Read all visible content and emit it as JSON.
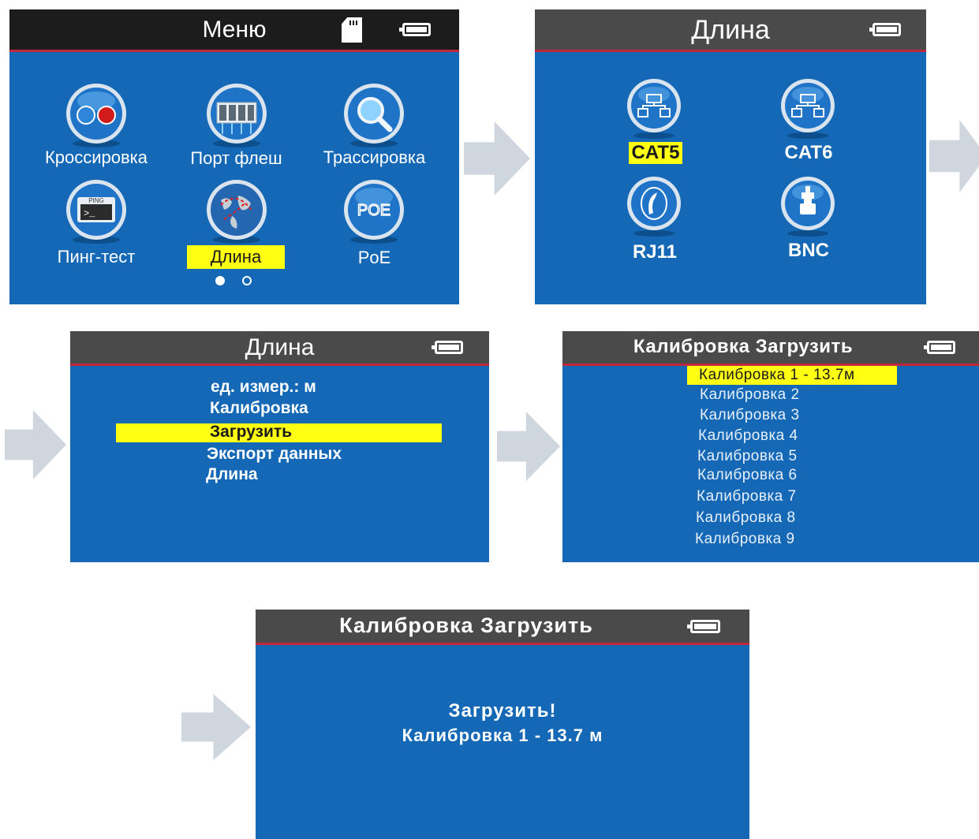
{
  "colors": {
    "screen_bg": "#1468b6",
    "header_dark": "#1c1c1c",
    "header_gray": "#4a4a4a",
    "header_underline": "#c2283a",
    "highlight": "#ffff14",
    "arrow": "#cfd6dd"
  },
  "screen_menu": {
    "title": "Меню",
    "icons": [
      "sd-card-icon",
      "battery-icon"
    ],
    "items": [
      {
        "label": "Кроссировка",
        "icon": "wiremap-icon"
      },
      {
        "label": "Порт флеш",
        "icon": "port-flash-icon"
      },
      {
        "label": "Трассировка",
        "icon": "tracing-magnifier-icon"
      },
      {
        "label": "Пинг-тест",
        "icon": "ping-terminal-icon"
      },
      {
        "label": "Длина",
        "icon": "length-globe-icon",
        "selected": true
      },
      {
        "label": "PoE",
        "icon": "poe-icon",
        "icon_text": "POE"
      }
    ],
    "page_indicator": {
      "current": 1,
      "total": 2
    }
  },
  "screen_cable": {
    "title": "Длина",
    "items": [
      {
        "label": "CAT5",
        "icon": "rj45-icon",
        "selected": true
      },
      {
        "label": "CAT6",
        "icon": "rj45-icon"
      },
      {
        "label": "RJ11",
        "icon": "phone-icon"
      },
      {
        "label": "BNC",
        "icon": "bnc-connector-icon"
      }
    ]
  },
  "screen_length_menu": {
    "title": "Длина",
    "items": [
      {
        "label": "ед. измер.: м"
      },
      {
        "label": "Калибровка"
      },
      {
        "label": "Загрузить",
        "selected": true
      },
      {
        "label": "Экспорт данных"
      },
      {
        "label": "Длина"
      }
    ]
  },
  "screen_calibration_list": {
    "title": "Калибровка Загрузить",
    "items": [
      {
        "label": "Калибровка 1 - 13.7м",
        "selected": true
      },
      {
        "label": "Калибровка 2"
      },
      {
        "label": "Калибровка 3"
      },
      {
        "label": "Калибровка 4"
      },
      {
        "label": "Калибровка 5"
      },
      {
        "label": "Калибровка 6"
      },
      {
        "label": "Калибровка 7"
      },
      {
        "label": "Калибровка 8"
      },
      {
        "label": "Калибровка 9"
      }
    ]
  },
  "screen_confirm": {
    "title": "Калибровка Загрузить",
    "message_line1": "Загрузить!",
    "message_line2": "Калибровка 1 - 13.7 м"
  }
}
